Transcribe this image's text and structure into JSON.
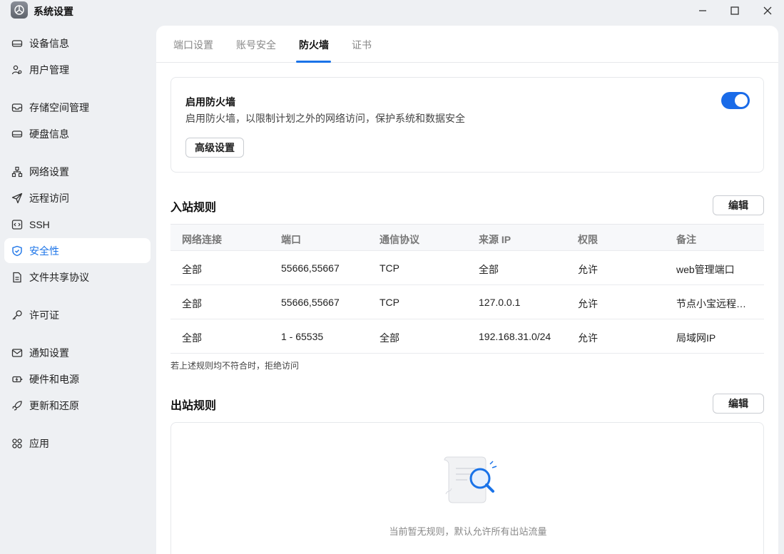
{
  "window": {
    "title": "系统设置"
  },
  "sidebar": {
    "items": [
      {
        "label": "设备信息",
        "icon": "device-icon"
      },
      {
        "label": "用户管理",
        "icon": "users-icon"
      },
      {
        "label": "存储空间管理",
        "icon": "storage-icon"
      },
      {
        "label": "硬盘信息",
        "icon": "disk-icon"
      },
      {
        "label": "网络设置",
        "icon": "network-icon"
      },
      {
        "label": "远程访问",
        "icon": "send-icon"
      },
      {
        "label": "SSH",
        "icon": "code-icon"
      },
      {
        "label": "安全性",
        "icon": "shield-icon",
        "active": true
      },
      {
        "label": "文件共享协议",
        "icon": "file-icon"
      },
      {
        "label": "许可证",
        "icon": "key-icon"
      },
      {
        "label": "通知设置",
        "icon": "mail-icon"
      },
      {
        "label": "硬件和电源",
        "icon": "power-icon"
      },
      {
        "label": "更新和还原",
        "icon": "rocket-icon"
      },
      {
        "label": "应用",
        "icon": "apps-icon"
      }
    ]
  },
  "tabs": [
    {
      "label": "端口设置"
    },
    {
      "label": "账号安全"
    },
    {
      "label": "防火墙",
      "active": true
    },
    {
      "label": "证书"
    }
  ],
  "firewall": {
    "title": "启用防火墙",
    "description": "启用防火墙，以限制计划之外的网络访问，保护系统和数据安全",
    "enabled": true,
    "advanced_button": "高级设置"
  },
  "inbound": {
    "title": "入站规则",
    "edit_button": "编辑",
    "columns": [
      "网络连接",
      "端口",
      "通信协议",
      "来源 IP",
      "权限",
      "备注"
    ],
    "rows": [
      [
        "全部",
        "55666,55667",
        "TCP",
        "全部",
        "允许",
        "web管理端口"
      ],
      [
        "全部",
        "55666,55667",
        "TCP",
        "127.0.0.1",
        "允许",
        "节点小宝远程…"
      ],
      [
        "全部",
        "1 - 65535",
        "全部",
        "192.168.31.0/24",
        "允许",
        "局域网IP"
      ]
    ],
    "note": "若上述规则均不符合时，拒绝访问"
  },
  "outbound": {
    "title": "出站规则",
    "edit_button": "编辑",
    "empty_text": "当前暂无规则，默认允许所有出站流量"
  },
  "colors": {
    "accent": "#1a73e8",
    "background": "#eef0f3",
    "panel": "#ffffff"
  }
}
